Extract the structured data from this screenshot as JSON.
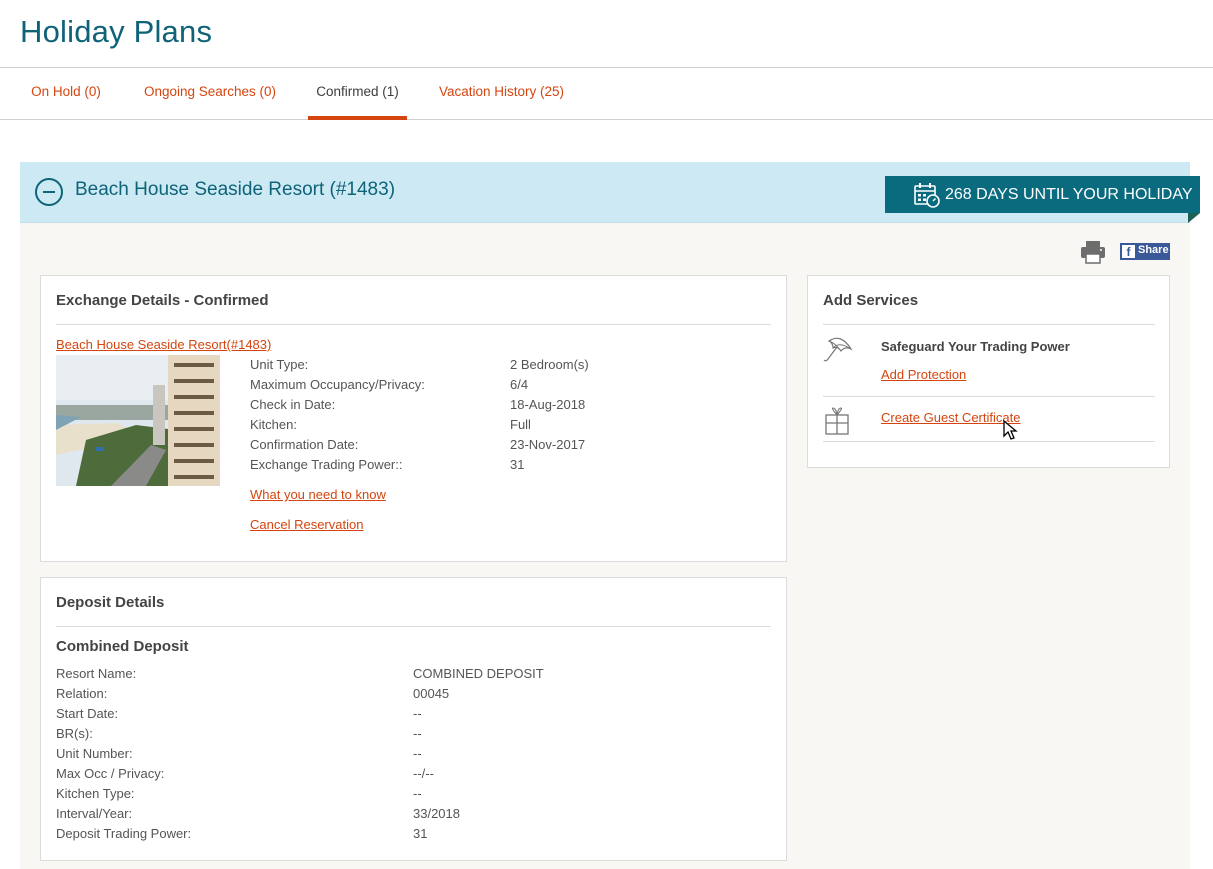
{
  "page": {
    "title": "Holiday Plans"
  },
  "tabs": [
    {
      "label": "On Hold (0)",
      "active": false
    },
    {
      "label": "Ongoing Searches (0)",
      "active": false
    },
    {
      "label": "Confirmed (1)",
      "active": true
    },
    {
      "label": "Vacation History (25)",
      "active": false
    }
  ],
  "reservation": {
    "title": "Beach House Seaside Resort (#1483)",
    "countdown": "268 DAYS UNTIL YOUR HOLIDAY",
    "share_label": "Share",
    "share_icon": "f"
  },
  "exchange": {
    "title": "Exchange Details - Confirmed",
    "resort_link": "Beach House Seaside Resort(#1483)",
    "details": [
      {
        "label": "Unit Type:",
        "value": "2 Bedroom(s)"
      },
      {
        "label": "Maximum Occupancy/Privacy:",
        "value": "6/4"
      },
      {
        "label": "Check in Date:",
        "value": "18-Aug-2018"
      },
      {
        "label": "Kitchen:",
        "value": "Full"
      },
      {
        "label": "Confirmation Date:",
        "value": "23-Nov-2017"
      },
      {
        "label": "Exchange Trading Power::",
        "value": "31"
      }
    ],
    "what_you_need_link": "What you need to know",
    "cancel_link": "Cancel Reservation"
  },
  "deposit": {
    "title": "Deposit Details",
    "subtitle": "Combined Deposit",
    "details": [
      {
        "label": "Resort Name:",
        "value": "COMBINED DEPOSIT"
      },
      {
        "label": "Relation:",
        "value": "00045"
      },
      {
        "label": "Start Date:",
        "value": "--"
      },
      {
        "label": "BR(s):",
        "value": "--"
      },
      {
        "label": "Unit Number:",
        "value": "--"
      },
      {
        "label": "Max Occ / Privacy:",
        "value": "--/--"
      },
      {
        "label": "Kitchen Type:",
        "value": "--"
      },
      {
        "label": "Interval/Year:",
        "value": "33/2018"
      },
      {
        "label": "Deposit Trading Power:",
        "value": "31"
      }
    ]
  },
  "services": {
    "title": "Add Services",
    "safeguard_heading": "Safeguard Your Trading Power",
    "add_protection_link": "Add Protection",
    "guest_certificate_link": "Create Guest Certificate"
  },
  "colors": {
    "brand_teal": "#0e6378",
    "accent_orange": "#d5450f",
    "banner_bg": "#cdeaf4",
    "countdown_bg": "#0a6b7f",
    "facebook": "#3b5998"
  }
}
